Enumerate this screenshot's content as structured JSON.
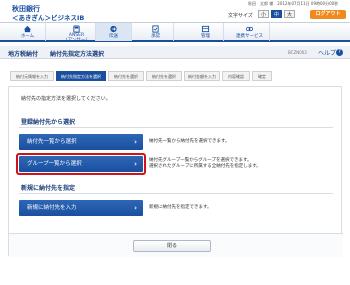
{
  "header": {
    "bank_name": "秋田銀行",
    "service_name": "＜あきぎん＞ビジネスIB",
    "user_info": "秋田　太郎 様　2012年07月11日 09時00分00秒",
    "font_size_label": "文字サイズ",
    "font_sizes": [
      "小",
      "中",
      "大"
    ],
    "logout": "ログアウト"
  },
  "nav": {
    "items": [
      {
        "label": "ホーム",
        "icon": "home-icon"
      },
      {
        "label": "ANSER\n(アンサー)",
        "icon": "anser-icon"
      },
      {
        "label": "伝送",
        "icon": "transmission-icon"
      },
      {
        "label": "承認",
        "icon": "approval-icon"
      },
      {
        "label": "管理",
        "icon": "management-icon"
      },
      {
        "label": "連携サービス",
        "icon": "link-service-icon"
      }
    ],
    "active_index": 2
  },
  "title_bar": {
    "main": "地方税納付",
    "sub": "納付先指定方法選択",
    "screen_id": "BCZN003",
    "help": "ヘルプ",
    "help_icon": "?"
  },
  "steps": [
    "納付元情報を入力",
    "納付先指定方法を選択",
    "納付先を選択",
    "納付先を選択",
    "納付金額を入力",
    "内容確認",
    "確定"
  ],
  "active_step": 1,
  "main": {
    "instruction": "納付先の指定方法を選択してください。",
    "section1_title": "登録納付先から選択",
    "btn_list": "納付先一覧から選択",
    "desc_list": "納付先一覧から納付先を選択できます。",
    "btn_group": "グループ一覧から選択",
    "desc_group_1": "納付先グループ一覧からグループを選択できます。",
    "desc_group_2": "選択されたグループに所属する全納付先を指定します。",
    "section2_title": "新規に納付先を指定",
    "btn_new": "新規に納付先を入力",
    "desc_new": "新規に納付先を指定できます。",
    "close": "閉る"
  },
  "chevron": "›"
}
